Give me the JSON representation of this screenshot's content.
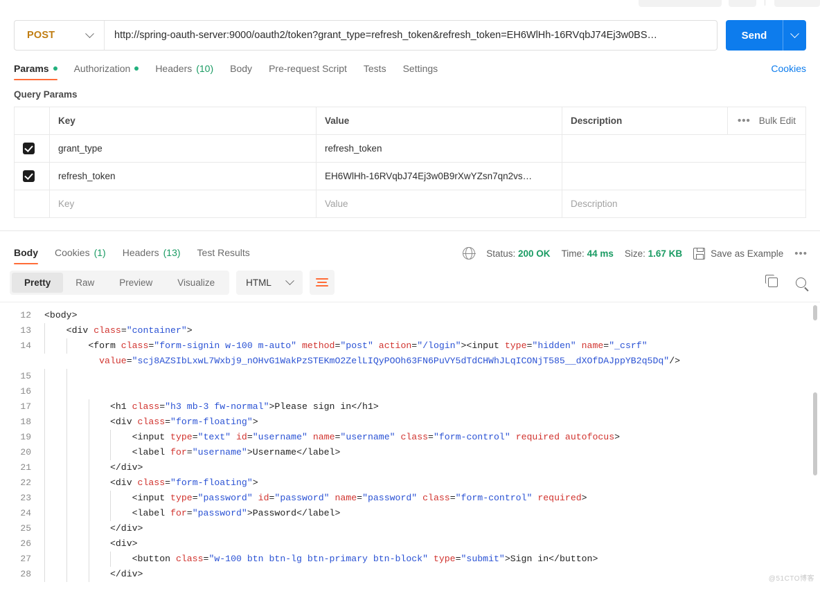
{
  "request": {
    "method": "POST",
    "url": "http://spring-oauth-server:9000/oauth2/token?grant_type=refresh_token&refresh_token=EH6WlHh-16RVqbJ74Ej3w0BS…",
    "send_label": "Send",
    "tabs": [
      {
        "label": "Params",
        "dot": true,
        "active": true
      },
      {
        "label": "Authorization",
        "dot": true,
        "active": false
      },
      {
        "label": "Headers",
        "count": "(10)",
        "active": false
      },
      {
        "label": "Body",
        "active": false
      },
      {
        "label": "Pre-request Script",
        "active": false
      },
      {
        "label": "Tests",
        "active": false
      },
      {
        "label": "Settings",
        "active": false
      }
    ],
    "cookies_link": "Cookies"
  },
  "params": {
    "section_title": "Query Params",
    "headers": [
      "Key",
      "Value",
      "Description"
    ],
    "bulk_edit_label": "Bulk Edit",
    "ellipsis_label": "•••",
    "rows": [
      {
        "checked": true,
        "key": "grant_type",
        "value": "refresh_token",
        "description": ""
      },
      {
        "checked": true,
        "key": "refresh_token",
        "value": "EH6WlHh-16RVqbJ74Ej3w0B9rXwYZsn7qn2vs…",
        "description": ""
      }
    ],
    "placeholder_row": {
      "key": "Key",
      "value": "Value",
      "description": "Description"
    }
  },
  "response": {
    "tabs": [
      {
        "label": "Body",
        "active": true
      },
      {
        "label": "Cookies",
        "count": "(1)",
        "active": false
      },
      {
        "label": "Headers",
        "count": "(13)",
        "active": false
      },
      {
        "label": "Test Results",
        "active": false
      }
    ],
    "status_label": "Status:",
    "status_value": "200 OK",
    "time_label": "Time:",
    "time_value": "44 ms",
    "size_label": "Size:",
    "size_value": "1.67 KB",
    "save_as_example": "Save as Example",
    "more_label": "•••",
    "view_modes": [
      {
        "label": "Pretty",
        "active": true
      },
      {
        "label": "Raw",
        "active": false
      },
      {
        "label": "Preview",
        "active": false
      },
      {
        "label": "Visualize",
        "active": false
      }
    ],
    "format": "HTML"
  },
  "colors": {
    "accent": "#ff6c37",
    "send_blue": "#0d7ced",
    "method_orange": "#c07d12",
    "success_green": "#1a9b63",
    "string_blue": "#2a52d4",
    "attr_red": "#d1332e"
  },
  "code": {
    "watermark": "@51CTO博客",
    "lines": [
      {
        "n": "12",
        "indent": 0,
        "parts": [
          {
            "t": "tag",
            "s": "<body>"
          }
        ]
      },
      {
        "n": "13",
        "indent": 1,
        "parts": [
          {
            "t": "tag",
            "s": "<div "
          },
          {
            "t": "attr",
            "s": "class"
          },
          {
            "t": "tag",
            "s": "="
          },
          {
            "t": "str",
            "s": "\"container\""
          },
          {
            "t": "tag",
            "s": ">"
          }
        ]
      },
      {
        "n": "14",
        "indent": 2,
        "parts": [
          {
            "t": "tag",
            "s": "<form "
          },
          {
            "t": "attr",
            "s": "class"
          },
          {
            "t": "tag",
            "s": "="
          },
          {
            "t": "str",
            "s": "\"form-signin w-100 m-auto\""
          },
          {
            "t": "tag",
            "s": " "
          },
          {
            "t": "attr",
            "s": "method"
          },
          {
            "t": "tag",
            "s": "="
          },
          {
            "t": "str",
            "s": "\"post\""
          },
          {
            "t": "tag",
            "s": " "
          },
          {
            "t": "attr",
            "s": "action"
          },
          {
            "t": "tag",
            "s": "="
          },
          {
            "t": "str",
            "s": "\"/login\""
          },
          {
            "t": "tag",
            "s": "><input "
          },
          {
            "t": "attr",
            "s": "type"
          },
          {
            "t": "tag",
            "s": "="
          },
          {
            "t": "str",
            "s": "\"hidden\""
          },
          {
            "t": "tag",
            "s": " "
          },
          {
            "t": "attr",
            "s": "name"
          },
          {
            "t": "tag",
            "s": "="
          },
          {
            "t": "str",
            "s": "\"_csrf\""
          }
        ],
        "cont": [
          {
            "t": "attr",
            "s": "value"
          },
          {
            "t": "tag",
            "s": "="
          },
          {
            "t": "str",
            "s": "\"scj8AZSIbLxwL7Wxbj9_nOHvG1WakPzSTEKmO2ZelLIQyPOOh63FN6PuVY5dTdCHWhJLqICONjT585__dXOfDAJppYB2q5Dq\""
          },
          {
            "t": "tag",
            "s": "/>"
          }
        ]
      },
      {
        "n": "15",
        "indent": 2,
        "parts": []
      },
      {
        "n": "16",
        "indent": 2,
        "parts": []
      },
      {
        "n": "17",
        "indent": 3,
        "parts": [
          {
            "t": "tag",
            "s": "<h1 "
          },
          {
            "t": "attr",
            "s": "class"
          },
          {
            "t": "tag",
            "s": "="
          },
          {
            "t": "str",
            "s": "\"h3 mb-3 fw-normal\""
          },
          {
            "t": "tag",
            "s": ">"
          },
          {
            "t": "txt",
            "s": "Please sign in"
          },
          {
            "t": "tag",
            "s": "</h1>"
          }
        ]
      },
      {
        "n": "18",
        "indent": 3,
        "parts": [
          {
            "t": "tag",
            "s": "<div "
          },
          {
            "t": "attr",
            "s": "class"
          },
          {
            "t": "tag",
            "s": "="
          },
          {
            "t": "str",
            "s": "\"form-floating\""
          },
          {
            "t": "tag",
            "s": ">"
          }
        ]
      },
      {
        "n": "19",
        "indent": 4,
        "parts": [
          {
            "t": "tag",
            "s": "<input "
          },
          {
            "t": "attr",
            "s": "type"
          },
          {
            "t": "tag",
            "s": "="
          },
          {
            "t": "str",
            "s": "\"text\""
          },
          {
            "t": "tag",
            "s": " "
          },
          {
            "t": "attr",
            "s": "id"
          },
          {
            "t": "tag",
            "s": "="
          },
          {
            "t": "str",
            "s": "\"username\""
          },
          {
            "t": "tag",
            "s": " "
          },
          {
            "t": "attr",
            "s": "name"
          },
          {
            "t": "tag",
            "s": "="
          },
          {
            "t": "str",
            "s": "\"username\""
          },
          {
            "t": "tag",
            "s": " "
          },
          {
            "t": "attr",
            "s": "class"
          },
          {
            "t": "tag",
            "s": "="
          },
          {
            "t": "str",
            "s": "\"form-control\""
          },
          {
            "t": "tag",
            "s": " "
          },
          {
            "t": "attr",
            "s": "required autofocus"
          },
          {
            "t": "tag",
            "s": ">"
          }
        ]
      },
      {
        "n": "20",
        "indent": 4,
        "parts": [
          {
            "t": "tag",
            "s": "<label "
          },
          {
            "t": "attr",
            "s": "for"
          },
          {
            "t": "tag",
            "s": "="
          },
          {
            "t": "str",
            "s": "\"username\""
          },
          {
            "t": "tag",
            "s": ">"
          },
          {
            "t": "txt",
            "s": "Username"
          },
          {
            "t": "tag",
            "s": "</label>"
          }
        ]
      },
      {
        "n": "21",
        "indent": 3,
        "parts": [
          {
            "t": "tag",
            "s": "</div>"
          }
        ]
      },
      {
        "n": "22",
        "indent": 3,
        "parts": [
          {
            "t": "tag",
            "s": "<div "
          },
          {
            "t": "attr",
            "s": "class"
          },
          {
            "t": "tag",
            "s": "="
          },
          {
            "t": "str",
            "s": "\"form-floating\""
          },
          {
            "t": "tag",
            "s": ">"
          }
        ]
      },
      {
        "n": "23",
        "indent": 4,
        "parts": [
          {
            "t": "tag",
            "s": "<input "
          },
          {
            "t": "attr",
            "s": "type"
          },
          {
            "t": "tag",
            "s": "="
          },
          {
            "t": "str",
            "s": "\"password\""
          },
          {
            "t": "tag",
            "s": " "
          },
          {
            "t": "attr",
            "s": "id"
          },
          {
            "t": "tag",
            "s": "="
          },
          {
            "t": "str",
            "s": "\"password\""
          },
          {
            "t": "tag",
            "s": " "
          },
          {
            "t": "attr",
            "s": "name"
          },
          {
            "t": "tag",
            "s": "="
          },
          {
            "t": "str",
            "s": "\"password\""
          },
          {
            "t": "tag",
            "s": " "
          },
          {
            "t": "attr",
            "s": "class"
          },
          {
            "t": "tag",
            "s": "="
          },
          {
            "t": "str",
            "s": "\"form-control\""
          },
          {
            "t": "tag",
            "s": " "
          },
          {
            "t": "attr",
            "s": "required"
          },
          {
            "t": "tag",
            "s": ">"
          }
        ]
      },
      {
        "n": "24",
        "indent": 4,
        "parts": [
          {
            "t": "tag",
            "s": "<label "
          },
          {
            "t": "attr",
            "s": "for"
          },
          {
            "t": "tag",
            "s": "="
          },
          {
            "t": "str",
            "s": "\"password\""
          },
          {
            "t": "tag",
            "s": ">"
          },
          {
            "t": "txt",
            "s": "Password"
          },
          {
            "t": "tag",
            "s": "</label>"
          }
        ]
      },
      {
        "n": "25",
        "indent": 3,
        "parts": [
          {
            "t": "tag",
            "s": "</div>"
          }
        ]
      },
      {
        "n": "26",
        "indent": 3,
        "parts": [
          {
            "t": "tag",
            "s": "<div>"
          }
        ]
      },
      {
        "n": "27",
        "indent": 4,
        "parts": [
          {
            "t": "tag",
            "s": "<button "
          },
          {
            "t": "attr",
            "s": "class"
          },
          {
            "t": "tag",
            "s": "="
          },
          {
            "t": "str",
            "s": "\"w-100 btn btn-lg btn-primary btn-block\""
          },
          {
            "t": "tag",
            "s": " "
          },
          {
            "t": "attr",
            "s": "type"
          },
          {
            "t": "tag",
            "s": "="
          },
          {
            "t": "str",
            "s": "\"submit\""
          },
          {
            "t": "tag",
            "s": ">"
          },
          {
            "t": "txt",
            "s": "Sign in"
          },
          {
            "t": "tag",
            "s": "</button>"
          }
        ]
      },
      {
        "n": "28",
        "indent": 3,
        "parts": [
          {
            "t": "tag",
            "s": "</div>"
          }
        ]
      }
    ]
  }
}
